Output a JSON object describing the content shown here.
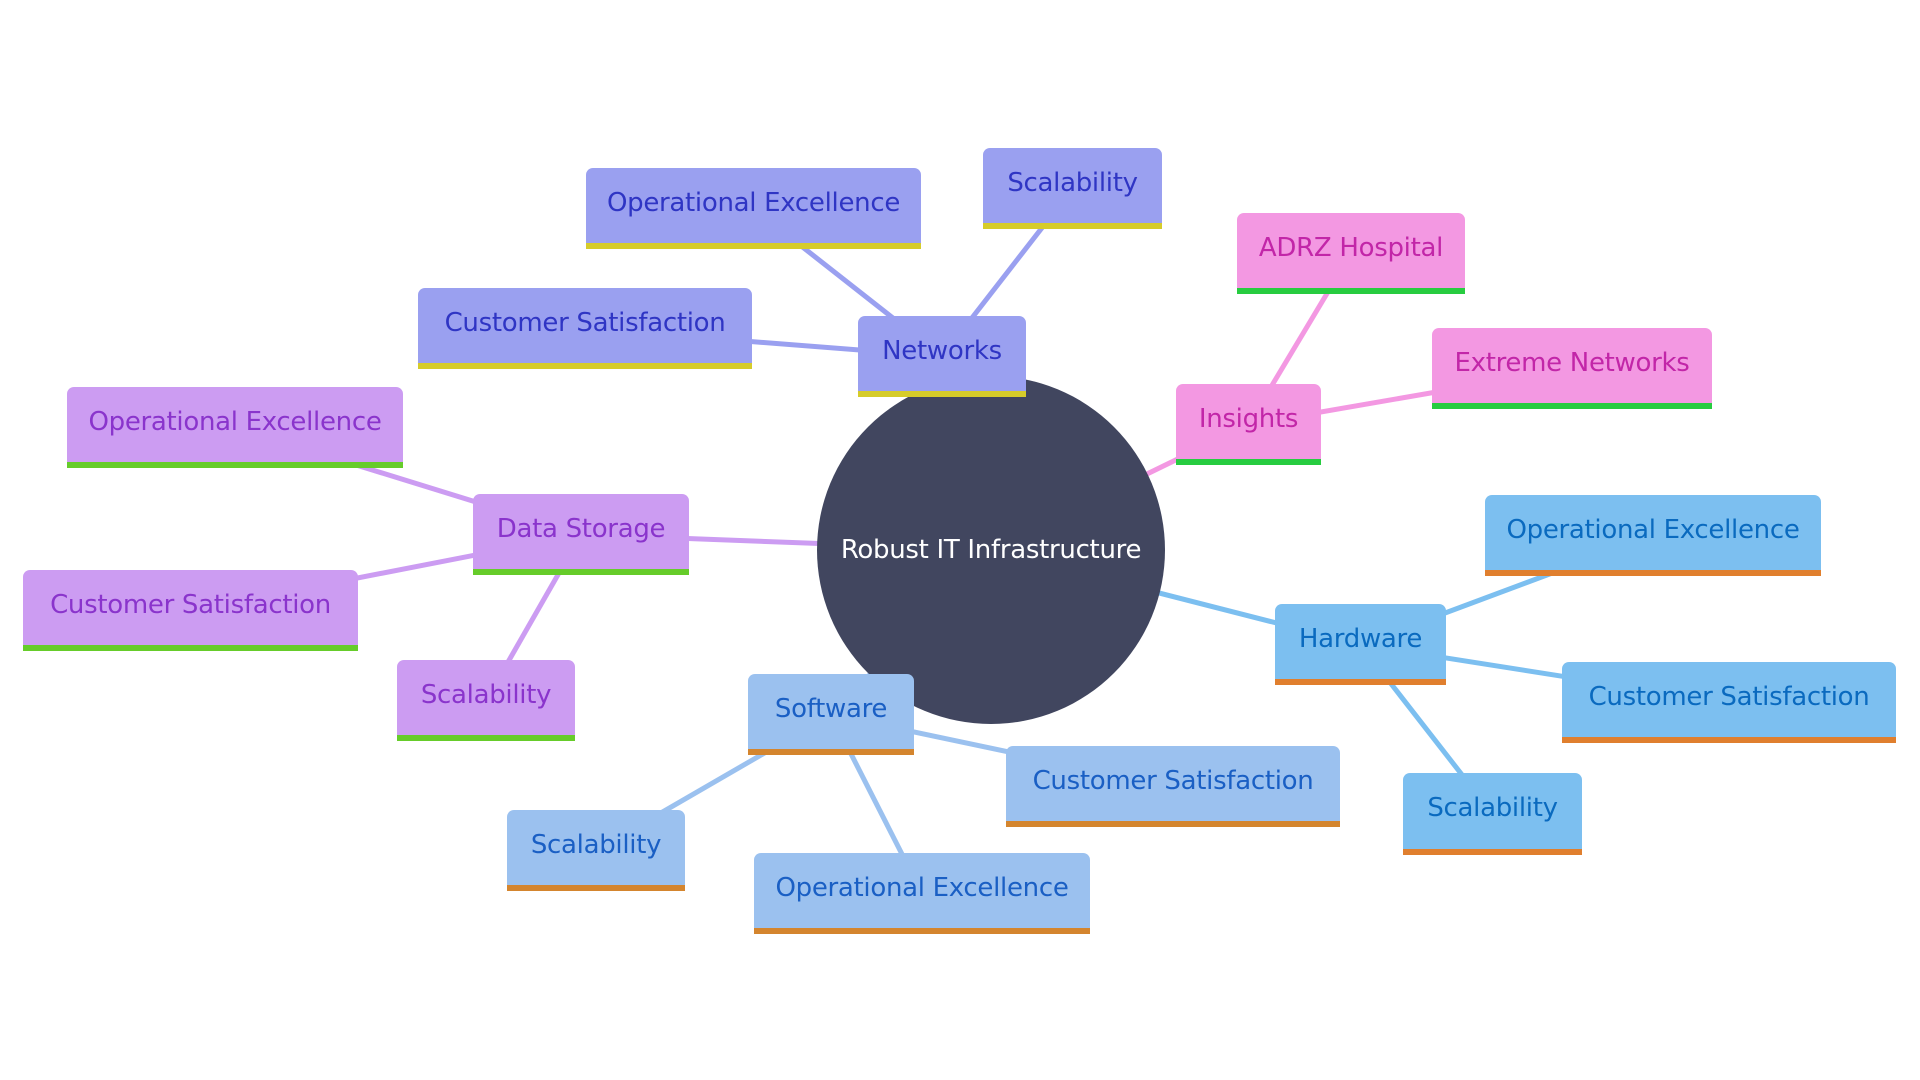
{
  "root": {
    "label": "Robust IT Infrastructure",
    "color": "#41465f"
  },
  "branches": [
    {
      "id": "networks",
      "label": "Networks",
      "fill": "#9aa0f0",
      "text_color": "#2f35c4",
      "accent": "#d6cc2a",
      "line_color": "#9aa0f0",
      "children": [
        {
          "label": "Operational Excellence"
        },
        {
          "label": "Scalability"
        },
        {
          "label": "Customer Satisfaction"
        }
      ]
    },
    {
      "id": "insights",
      "label": "Insights",
      "fill": "#f398e2",
      "text_color": "#c226a8",
      "accent": "#27cc40",
      "line_color": "#f398e2",
      "children": [
        {
          "label": "ADRZ Hospital"
        },
        {
          "label": "Extreme Networks"
        }
      ]
    },
    {
      "id": "hardware",
      "label": "Hardware",
      "fill": "#7cbff0",
      "text_color": "#0a6abf",
      "accent": "#e07f2e",
      "line_color": "#7cbff0",
      "children": [
        {
          "label": "Operational Excellence"
        },
        {
          "label": "Customer Satisfaction"
        },
        {
          "label": "Scalability"
        }
      ]
    },
    {
      "id": "software",
      "label": "Software",
      "fill": "#9bc1ef",
      "text_color": "#1a5fc4",
      "accent": "#d4852e",
      "line_color": "#9bc1ef",
      "children": [
        {
          "label": "Customer Satisfaction"
        },
        {
          "label": "Scalability"
        },
        {
          "label": "Operational Excellence"
        }
      ]
    },
    {
      "id": "storage",
      "label": "Data Storage",
      "fill": "#cc9cf2",
      "text_color": "#8a34cc",
      "accent": "#66cc2a",
      "line_color": "#cc9cf2",
      "children": [
        {
          "label": "Operational Excellence"
        },
        {
          "label": "Customer Satisfaction"
        },
        {
          "label": "Scalability"
        }
      ]
    }
  ]
}
